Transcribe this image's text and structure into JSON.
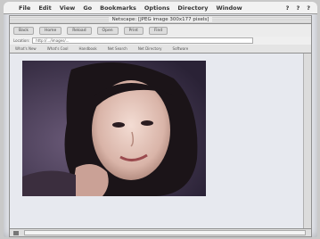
{
  "menubar": {
    "apple_icon": "apple-icon",
    "items": [
      "File",
      "Edit",
      "View",
      "Go",
      "Bookmarks",
      "Options",
      "Directory",
      "Window"
    ],
    "right_items": [
      "?",
      "?",
      "?"
    ]
  },
  "window": {
    "title": "Netscape: [JPEG image 300x177 pixels]"
  },
  "toolbar": {
    "buttons": [
      "Back",
      "Home",
      "Reload",
      "Open",
      "Print",
      "Find"
    ]
  },
  "location": {
    "label": "Location:",
    "value": "http://.../images/..."
  },
  "directory_buttons": [
    "What's New",
    "What's Cool",
    "Handbook",
    "Net Search",
    "Net Directory",
    "Software"
  ],
  "statusbar": {
    "icon": "netscape-status-icon"
  }
}
